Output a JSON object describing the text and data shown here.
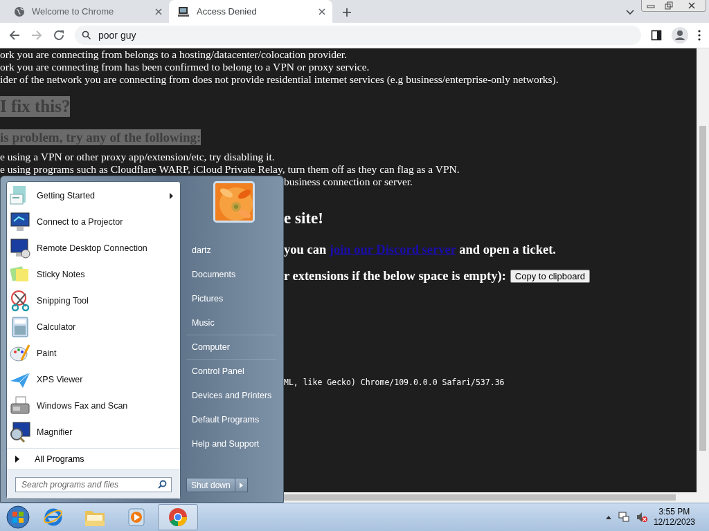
{
  "browser": {
    "tabs": [
      {
        "title": "Welcome to Chrome",
        "selected": false
      },
      {
        "title": "Access Denied",
        "selected": true
      }
    ],
    "address": "poor guy"
  },
  "page": {
    "top_lines": [
      {
        "kind": "text",
        "text": "ork you are connecting from belongs to a hosting/datacenter/colocation provider."
      },
      {
        "kind": "text",
        "text": "ork you are connecting from has been confirmed to belong to a VPN or proxy service."
      },
      {
        "kind": "text",
        "text": "ider of the network you are connecting from does not provide residential internet services (e.g business/enterprise-only networks)."
      },
      {
        "kind": "heading",
        "text": "I fix this?"
      },
      {
        "kind": "subheading",
        "text": "is problem, try any of the following:"
      },
      {
        "kind": "text",
        "text": "e using a VPN or other proxy app/extension/etc, try disabling it."
      },
      {
        "kind": "text",
        "text": "e using programs such as Cloudflare WARP, iCloud Private Relay, turn them off as they can flag as a VPN."
      }
    ],
    "lower_lines": [
      {
        "kind": "text",
        "text": "business connection or server."
      },
      {
        "kind": "big",
        "text": "e site!"
      },
      {
        "kind": "link-line",
        "before": "you can ",
        "link": "join our Discord server",
        "after": " and open a ticket."
      },
      {
        "kind": "button-line",
        "text": "r extensions if the below space is empty):",
        "button": "Copy to clipboard"
      },
      {
        "kind": "mono",
        "text": "ML, like Gecko) Chrome/109.0.0.0 Safari/537.36"
      }
    ]
  },
  "start_menu": {
    "programs": [
      {
        "label": "Getting Started",
        "submenu": true
      },
      {
        "label": "Connect to a Projector",
        "submenu": false
      },
      {
        "label": "Remote Desktop Connection",
        "submenu": false
      },
      {
        "label": "Sticky Notes",
        "submenu": false
      },
      {
        "label": "Snipping Tool",
        "submenu": false
      },
      {
        "label": "Calculator",
        "submenu": false
      },
      {
        "label": "Paint",
        "submenu": false
      },
      {
        "label": "XPS Viewer",
        "submenu": false
      },
      {
        "label": "Windows Fax and Scan",
        "submenu": false
      },
      {
        "label": "Magnifier",
        "submenu": false
      }
    ],
    "all_programs": "All Programs",
    "search": {
      "placeholder": "Search programs and files"
    },
    "places": [
      {
        "label": "dartz",
        "separator_before": false
      },
      {
        "label": "Documents",
        "separator_before": false
      },
      {
        "label": "Pictures",
        "separator_before": false
      },
      {
        "label": "Music",
        "separator_before": false
      },
      {
        "label": "Computer",
        "separator_before": true
      },
      {
        "label": "Control Panel",
        "separator_before": true
      },
      {
        "label": "Devices and Printers",
        "separator_before": false
      },
      {
        "label": "Default Programs",
        "separator_before": false
      },
      {
        "label": "Help and Support",
        "separator_before": false
      }
    ],
    "shutdown": "Shut down"
  },
  "taskbar": {
    "apps": [
      {
        "selected": false
      },
      {
        "selected": false
      },
      {
        "selected": false
      },
      {
        "selected": true
      }
    ],
    "time": "3:55 PM",
    "date": "12/12/2023"
  }
}
